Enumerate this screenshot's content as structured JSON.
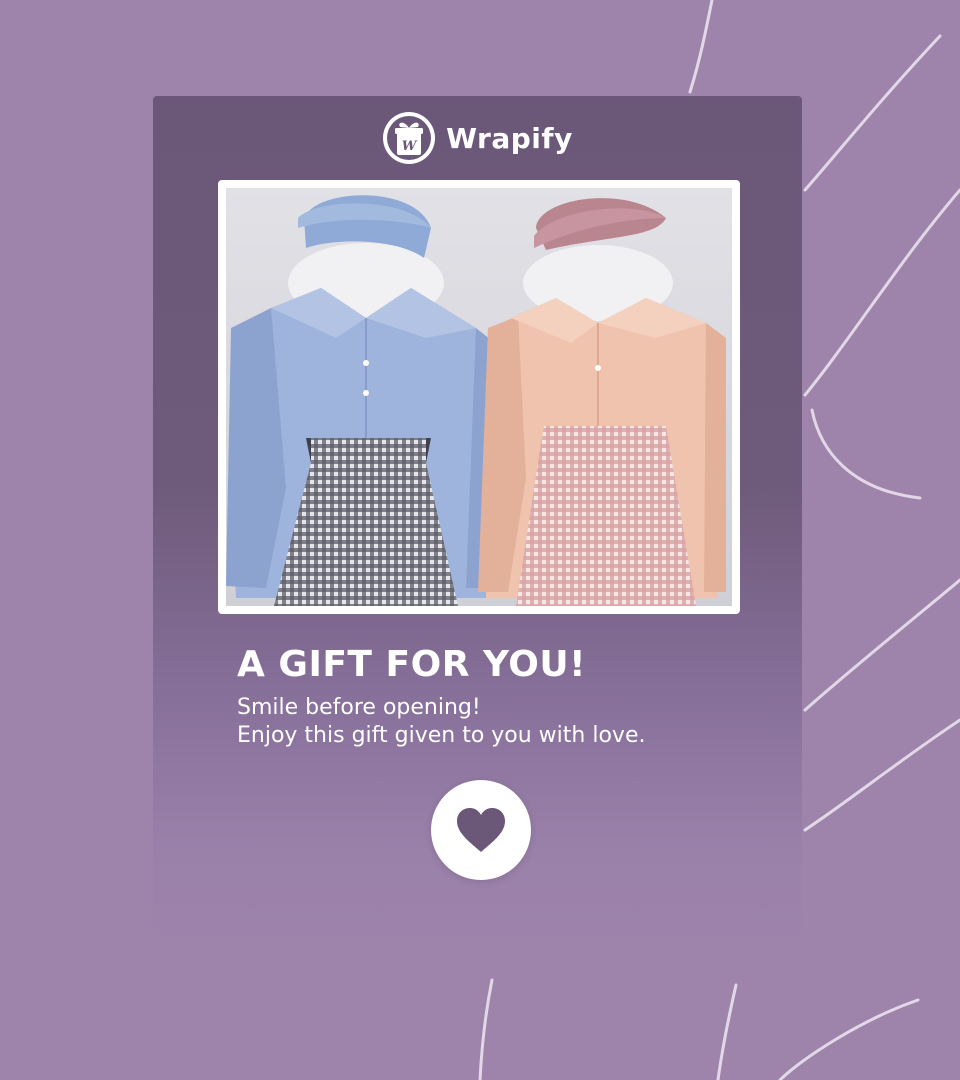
{
  "brand": {
    "name": "Wrapify",
    "logo_icon": "gift-box-logo-icon"
  },
  "photo": {
    "description_icon": "outfit-photo"
  },
  "gift": {
    "headline": "A GIFT FOR YOU!",
    "line1": "Smile before opening!",
    "line2": "Enjoy this gift given to you with love."
  },
  "action": {
    "icon": "heart-icon"
  },
  "colors": {
    "background": "#9e84ab",
    "card": "#6b5777",
    "heart": "#6b5777",
    "text": "#ffffff"
  }
}
